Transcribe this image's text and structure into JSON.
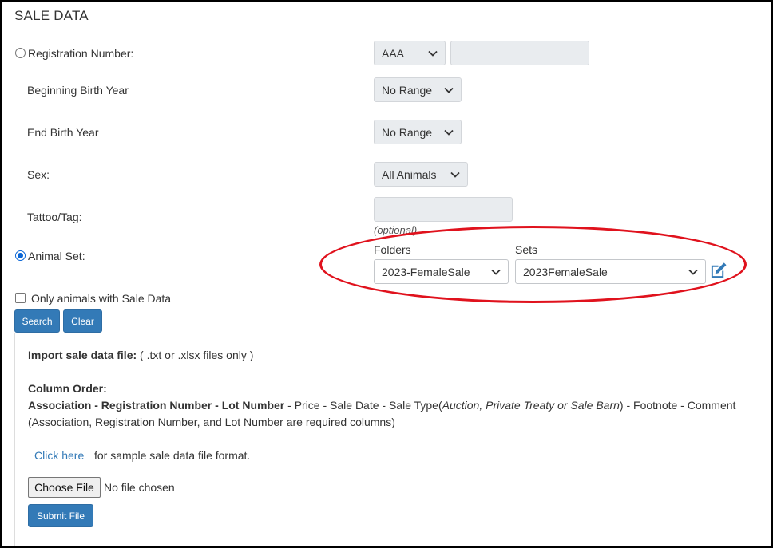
{
  "title": "SALE DATA",
  "registration": {
    "label": "Registration Number:",
    "prefix_value": "AAA",
    "number_value": ""
  },
  "beginning_birth_year": {
    "label": "Beginning Birth Year",
    "value": "No Range"
  },
  "end_birth_year": {
    "label": "End Birth Year",
    "value": "No Range"
  },
  "sex": {
    "label": "Sex:",
    "value": "All Animals"
  },
  "tattoo": {
    "label": "Tattoo/Tag:",
    "value": "",
    "hint": "(optional)"
  },
  "animal_set": {
    "label": "Animal Set:",
    "folders_label": "Folders",
    "folders_value": "2023-FemaleSale",
    "sets_label": "Sets",
    "sets_value": "2023FemaleSale"
  },
  "only_sale_data_label": "Only animals with Sale Data",
  "buttons": {
    "search": "Search",
    "clear": "Clear"
  },
  "import": {
    "heading_bold": "Import sale data file:",
    "heading_rest": " ( .txt or .xlsx files only )",
    "column_order_label": "Column Order:",
    "column_order_required": "Association - Registration Number - Lot Number",
    "column_order_rest_1": " - Price - Sale Date - Sale Type(",
    "column_order_sale_types": "Auction, Private Treaty or Sale Barn",
    "column_order_rest_2": ") - Footnote - Comment",
    "required_note": "(Association, Registration Number, and Lot Number are required columns)",
    "click_here": "Click here",
    "sample_text": "for sample sale data file format.",
    "choose_file": "Choose File",
    "no_file": "No file chosen",
    "submit": "Submit File"
  },
  "colors": {
    "accent": "#337ab7",
    "highlight": "#e0121d",
    "radio_checked": "#0a66d6"
  },
  "icons": {
    "chevron": "chevron-down-icon",
    "edit": "edit-icon"
  }
}
